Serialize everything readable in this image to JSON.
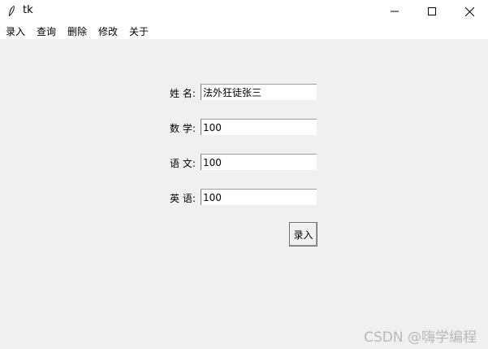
{
  "window": {
    "title": "tk",
    "controls": {
      "minimize": "minimize-icon",
      "maximize": "maximize-icon",
      "close": "close-icon"
    }
  },
  "menubar": {
    "items": [
      {
        "label": "录入"
      },
      {
        "label": "查询"
      },
      {
        "label": "删除"
      },
      {
        "label": "修改"
      },
      {
        "label": "关于"
      }
    ]
  },
  "form": {
    "fields": [
      {
        "label": "姓 名:",
        "value": "法外狂徒张三"
      },
      {
        "label": "数 学:",
        "value": "100"
      },
      {
        "label": "语 文:",
        "value": "100"
      },
      {
        "label": "英 语:",
        "value": "100"
      }
    ],
    "submit_label": "录入"
  },
  "watermark": "CSDN @嗨学编程"
}
